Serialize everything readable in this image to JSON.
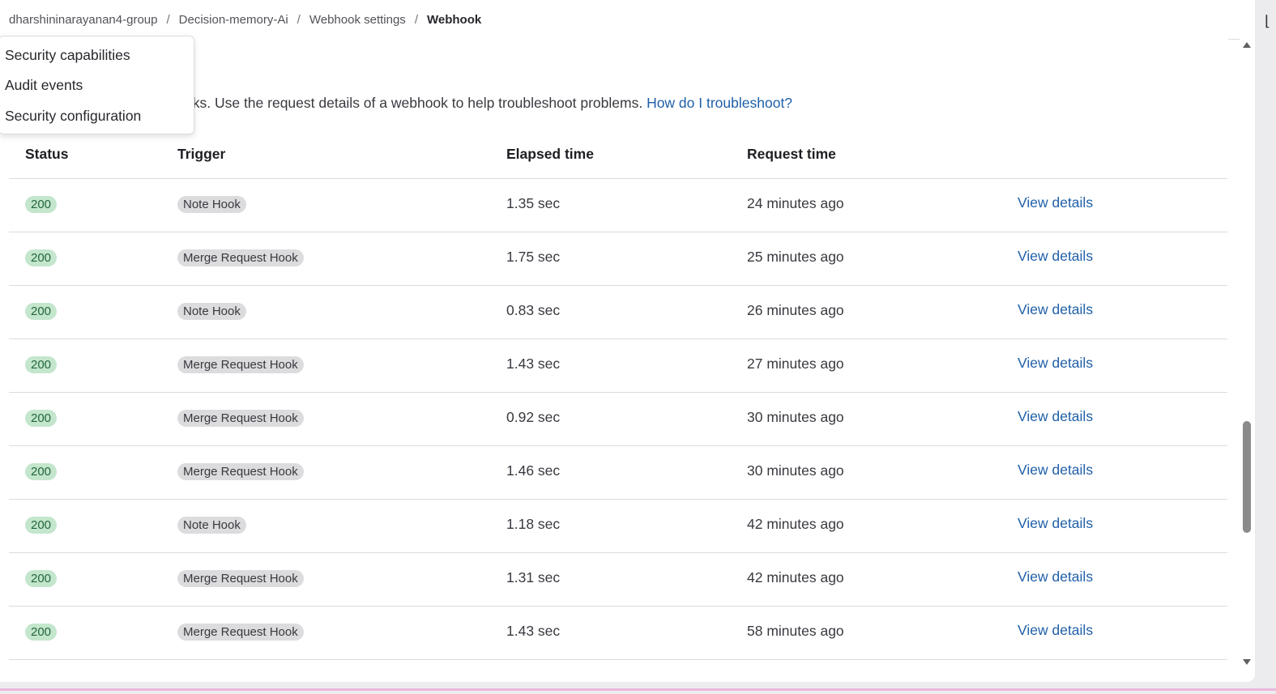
{
  "breadcrumb": {
    "items": [
      "dharshininarayanan4-group",
      "Decision-memory-Ai",
      "Webhook settings"
    ],
    "current": "Webhook",
    "separator": "/"
  },
  "dropdown": {
    "items": [
      "Security capabilities",
      "Audit events",
      "Security configuration"
    ]
  },
  "intro": {
    "text": "oks. Use the request details of a webhook to help troubleshoot problems. ",
    "link": "How do I troubleshoot?"
  },
  "table": {
    "headers": [
      "Status",
      "Trigger",
      "Elapsed time",
      "Request time"
    ],
    "rows": [
      {
        "status": "200",
        "trigger": "Note Hook",
        "elapsed": "1.35 sec",
        "request_time": "24 minutes ago",
        "action": "View details"
      },
      {
        "status": "200",
        "trigger": "Merge Request Hook",
        "elapsed": "1.75 sec",
        "request_time": "25 minutes ago",
        "action": "View details"
      },
      {
        "status": "200",
        "trigger": "Note Hook",
        "elapsed": "0.83 sec",
        "request_time": "26 minutes ago",
        "action": "View details"
      },
      {
        "status": "200",
        "trigger": "Merge Request Hook",
        "elapsed": "1.43 sec",
        "request_time": "27 minutes ago",
        "action": "View details"
      },
      {
        "status": "200",
        "trigger": "Merge Request Hook",
        "elapsed": "0.92 sec",
        "request_time": "30 minutes ago",
        "action": "View details"
      },
      {
        "status": "200",
        "trigger": "Merge Request Hook",
        "elapsed": "1.46 sec",
        "request_time": "30 minutes ago",
        "action": "View details"
      },
      {
        "status": "200",
        "trigger": "Note Hook",
        "elapsed": "1.18 sec",
        "request_time": "42 minutes ago",
        "action": "View details"
      },
      {
        "status": "200",
        "trigger": "Merge Request Hook",
        "elapsed": "1.31 sec",
        "request_time": "42 minutes ago",
        "action": "View details"
      },
      {
        "status": "200",
        "trigger": "Merge Request Hook",
        "elapsed": "1.43 sec",
        "request_time": "58 minutes ago",
        "action": "View details"
      }
    ]
  },
  "colors": {
    "link": "#1f5fa8",
    "status_success_bg": "#c3e6cd",
    "status_success_text": "#24663b",
    "badge_neutral_bg": "#dcdcde"
  }
}
